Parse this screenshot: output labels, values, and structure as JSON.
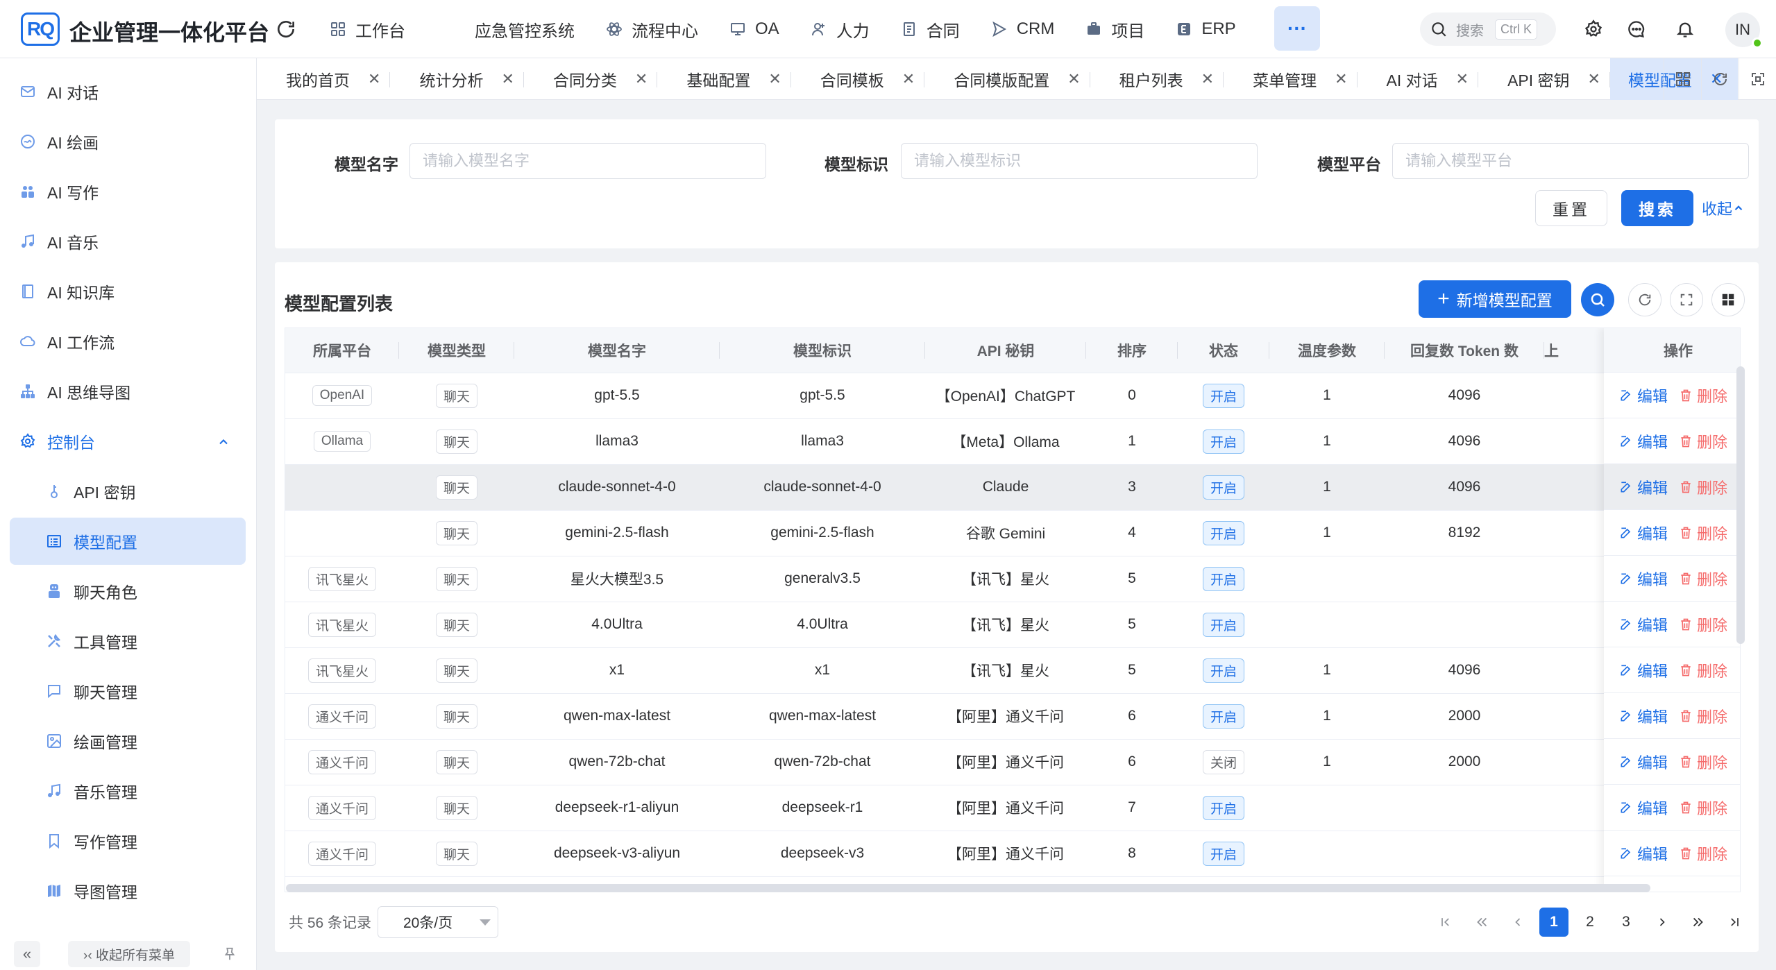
{
  "app": {
    "logo": "RQ",
    "title": "企业管理一体化平台"
  },
  "topnav": [
    {
      "label": "工作台",
      "icon": "grid-icon"
    },
    {
      "label": "应急管控系统",
      "icon": ""
    },
    {
      "label": "流程中心",
      "icon": "atom-icon"
    },
    {
      "label": "OA",
      "icon": "monitor-icon"
    },
    {
      "label": "人力",
      "icon": "user-icon"
    },
    {
      "label": "合同",
      "icon": "doc-icon"
    },
    {
      "label": "CRM",
      "icon": "send-icon"
    },
    {
      "label": "项目",
      "icon": "briefcase-icon"
    },
    {
      "label": "ERP",
      "icon": "erp-icon"
    }
  ],
  "header": {
    "more": "···",
    "search_label": "搜索",
    "search_kbd": "Ctrl K",
    "avatar": "IN"
  },
  "sidebar": {
    "items": [
      {
        "label": "AI 对话"
      },
      {
        "label": "AI 绘画"
      },
      {
        "label": "AI 写作"
      },
      {
        "label": "AI 音乐"
      },
      {
        "label": "AI 知识库"
      },
      {
        "label": "AI 工作流"
      },
      {
        "label": "AI 思维导图"
      },
      {
        "label": "控制台"
      },
      {
        "label": "API 密钥"
      },
      {
        "label": "模型配置"
      },
      {
        "label": "聊天角色"
      },
      {
        "label": "工具管理"
      },
      {
        "label": "聊天管理"
      },
      {
        "label": "绘画管理"
      },
      {
        "label": "音乐管理"
      },
      {
        "label": "写作管理"
      },
      {
        "label": "导图管理"
      }
    ],
    "collapse_small": "«",
    "collapse_all": "›‹ 收起所有菜单"
  },
  "tabs": [
    {
      "label": "我的首页"
    },
    {
      "label": "统计分析"
    },
    {
      "label": "合同分类"
    },
    {
      "label": "基础配置"
    },
    {
      "label": "合同模板"
    },
    {
      "label": "合同模版配置"
    },
    {
      "label": "租户列表"
    },
    {
      "label": "菜单管理"
    },
    {
      "label": "AI 对话"
    },
    {
      "label": "API 密钥"
    },
    {
      "label": "模型配置"
    }
  ],
  "filter": {
    "name_label": "模型名字",
    "name_placeholder": "请输入模型名字",
    "key_label": "模型标识",
    "key_placeholder": "请输入模型标识",
    "platform_label": "模型平台",
    "platform_placeholder": "请输入模型平台",
    "reset": "重置",
    "search": "搜索",
    "fold": "收起"
  },
  "list": {
    "title": "模型配置列表",
    "add_button": "新增模型配置",
    "columns": [
      "所属平台",
      "模型类型",
      "模型名字",
      "模型标识",
      "API 秘钥",
      "排序",
      "状态",
      "温度参数",
      "回复数 Token 数",
      "上"
    ],
    "op_column": "操作",
    "edit": "编辑",
    "delete": "删除",
    "rows": [
      {
        "platform": "OpenAI",
        "type": "聊天",
        "name": "gpt-5.5",
        "key": "gpt-5.5",
        "api": "【OpenAI】ChatGPT",
        "sort": "0",
        "status": "开启",
        "temp": "1",
        "tokens": "4096"
      },
      {
        "platform": "Ollama",
        "type": "聊天",
        "name": "llama3",
        "key": "llama3",
        "api": "【Meta】Ollama",
        "sort": "1",
        "status": "开启",
        "temp": "1",
        "tokens": "4096"
      },
      {
        "platform": "",
        "type": "聊天",
        "name": "claude-sonnet-4-0",
        "key": "claude-sonnet-4-0",
        "api": "Claude",
        "sort": "3",
        "status": "开启",
        "temp": "1",
        "tokens": "4096"
      },
      {
        "platform": "",
        "type": "聊天",
        "name": "gemini-2.5-flash",
        "key": "gemini-2.5-flash",
        "api": "谷歌 Gemini",
        "sort": "4",
        "status": "开启",
        "temp": "1",
        "tokens": "8192"
      },
      {
        "platform": "讯飞星火",
        "type": "聊天",
        "name": "星火大模型3.5",
        "key": "generalv3.5",
        "api": "【讯飞】星火",
        "sort": "5",
        "status": "开启",
        "temp": "",
        "tokens": ""
      },
      {
        "platform": "讯飞星火",
        "type": "聊天",
        "name": "4.0Ultra",
        "key": "4.0Ultra",
        "api": "【讯飞】星火",
        "sort": "5",
        "status": "开启",
        "temp": "",
        "tokens": ""
      },
      {
        "platform": "讯飞星火",
        "type": "聊天",
        "name": "x1",
        "key": "x1",
        "api": "【讯飞】星火",
        "sort": "5",
        "status": "开启",
        "temp": "1",
        "tokens": "4096"
      },
      {
        "platform": "通义千问",
        "type": "聊天",
        "name": "qwen-max-latest",
        "key": "qwen-max-latest",
        "api": "【阿里】通义千问",
        "sort": "6",
        "status": "开启",
        "temp": "1",
        "tokens": "2000"
      },
      {
        "platform": "通义千问",
        "type": "聊天",
        "name": "qwen-72b-chat",
        "key": "qwen-72b-chat",
        "api": "【阿里】通义千问",
        "sort": "6",
        "status": "关闭",
        "temp": "1",
        "tokens": "2000"
      },
      {
        "platform": "通义千问",
        "type": "聊天",
        "name": "deepseek-r1-aliyun",
        "key": "deepseek-r1",
        "api": "【阿里】通义千问",
        "sort": "7",
        "status": "开启",
        "temp": "",
        "tokens": ""
      },
      {
        "platform": "通义千问",
        "type": "聊天",
        "name": "deepseek-v3-aliyun",
        "key": "deepseek-v3",
        "api": "【阿里】通义千问",
        "sort": "8",
        "status": "开启",
        "temp": "",
        "tokens": ""
      }
    ]
  },
  "pagination": {
    "total": "共 56 条记录",
    "page_size": "20条/页",
    "pages": [
      "1",
      "2",
      "3"
    ],
    "current": "1"
  }
}
